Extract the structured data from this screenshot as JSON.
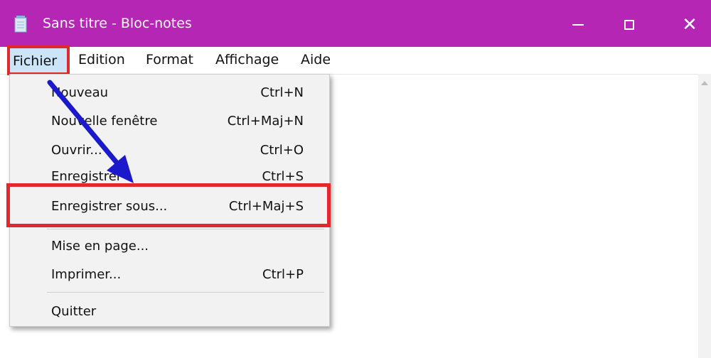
{
  "window": {
    "title": "Sans titre - Bloc-notes",
    "accent_color": "#b526b5",
    "controls": {
      "minimize_icon": "minimize-icon",
      "maximize_icon": "maximize-icon",
      "close_icon": "close-icon",
      "close_glyph": "✕"
    }
  },
  "menubar": {
    "items": [
      "Fichier",
      "Edition",
      "Format",
      "Affichage",
      "Aide"
    ],
    "active": "Fichier"
  },
  "file_menu": {
    "items": [
      {
        "label": "Nouveau",
        "shortcut": "Ctrl+N"
      },
      {
        "label": "Nouvelle fenêtre",
        "shortcut": "Ctrl+Maj+N"
      },
      {
        "label": "Ouvrir...",
        "shortcut": "Ctrl+O"
      },
      {
        "label": "Enregistrer",
        "shortcut": "Ctrl+S"
      },
      {
        "label": "Enregistrer sous...",
        "shortcut": "Ctrl+Maj+S"
      },
      {
        "label": "Mise en page...",
        "shortcut": ""
      },
      {
        "label": "Imprimer...",
        "shortcut": "Ctrl+P"
      },
      {
        "label": "Quitter",
        "shortcut": ""
      }
    ],
    "highlighted": "Enregistrer sous...",
    "highlight_color": "#e0282e",
    "arrow_color": "#1a1acc"
  }
}
